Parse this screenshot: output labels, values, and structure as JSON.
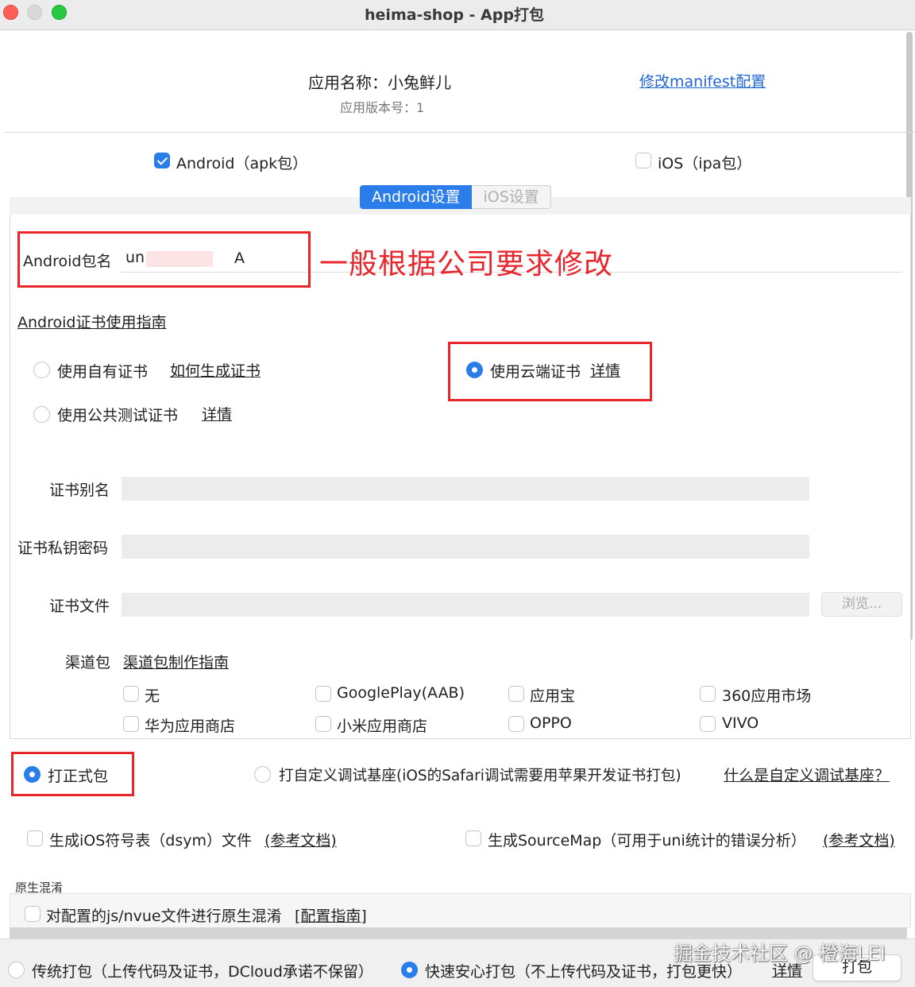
{
  "window": {
    "title": "heima-shop - App打包"
  },
  "header": {
    "app_name": "应用名称：小兔鲜儿",
    "app_version": "应用版本号：1",
    "manifest_link": "修改manifest配置"
  },
  "platforms": {
    "android": {
      "label": "Android（apk包）",
      "checked": true
    },
    "ios": {
      "label": "iOS（ipa包）",
      "checked": false
    }
  },
  "tabs": [
    {
      "label": "Android设置",
      "active": true
    },
    {
      "label": "iOS设置",
      "active": false
    }
  ],
  "android": {
    "package_label": "Android包名",
    "package_value_prefix": "un",
    "package_value_suffix": "A",
    "annotation": "一般根据公司要求修改",
    "cert_guide_link": "Android证书使用指南",
    "cert_options": [
      {
        "label": "使用自有证书",
        "link": "如何生成证书",
        "selected": false
      },
      {
        "label": "使用公共测试证书",
        "link": "详情",
        "selected": false
      },
      {
        "label": "使用云端证书",
        "link": "详情",
        "selected": true
      }
    ],
    "fields": {
      "alias_label": "证书别名",
      "password_label": "证书私钥密码",
      "file_label": "证书文件",
      "browse_label": "浏览..."
    },
    "channel": {
      "label": "渠道包",
      "guide_link": "渠道包制作指南",
      "items": [
        "无",
        "GooglePlay(AAB)",
        "应用宝",
        "360应用市场",
        "华为应用商店",
        "小米应用商店",
        "OPPO",
        "VIVO"
      ]
    }
  },
  "build_type": {
    "release": {
      "label": "打正式包",
      "selected": true
    },
    "custom_base": {
      "label": "打自定义调试基座(iOS的Safari调试需要用苹果开发证书打包)",
      "selected": false
    },
    "custom_base_link": "什么是自定义调试基座？"
  },
  "options": {
    "dsym": {
      "label": "生成iOS符号表（dsym）文件",
      "link": "(参考文档)",
      "checked": false
    },
    "sourcemap": {
      "label": "生成SourceMap（可用于uni统计的错误分析）",
      "link": "(参考文档)",
      "checked": false
    }
  },
  "obfuscation": {
    "section_label": "原生混淆",
    "label": "对配置的js/nvue文件进行原生混淆",
    "link": "[配置指南]",
    "checked": false
  },
  "footer": {
    "traditional": {
      "label": "传统打包（上传代码及证书，DCloud承诺不保留）",
      "selected": false
    },
    "fast": {
      "label": "快速安心打包（不上传代码及证书，打包更快）",
      "selected": true
    },
    "details_link": "详情",
    "pack_button": "打包",
    "watermark": "掘金技术社区 @ 橙海LEI"
  },
  "colors": {
    "accent": "#2b7de9",
    "annotation_red": "#e8262c",
    "link": "#2266d2"
  }
}
